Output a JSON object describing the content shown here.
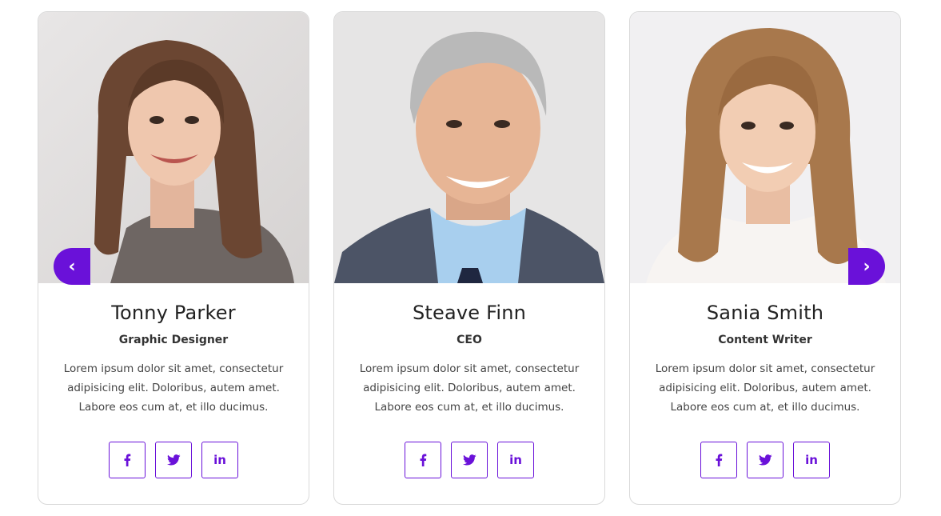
{
  "carousel": {
    "prev_icon": "‹",
    "next_icon": "›",
    "accent_color": "#6a11d9"
  },
  "members": [
    {
      "name": "Tonny Parker",
      "role": "Graphic Designer",
      "bio": "Lorem ipsum dolor sit amet, consectetur adipisicing elit. Doloribus, autem amet. Labore eos cum at, et illo ducimus.",
      "photo_icon": "woman-brown-hair-photo",
      "social": {
        "facebook": "facebook-icon",
        "twitter": "twitter-icon",
        "linkedin": "in"
      }
    },
    {
      "name": "Steave Finn",
      "role": "CEO",
      "bio": "Lorem ipsum dolor sit amet, consectetur adipisicing elit. Doloribus, autem amet. Labore eos cum at, et illo ducimus.",
      "photo_icon": "man-gray-hair-suit-photo",
      "social": {
        "facebook": "facebook-icon",
        "twitter": "twitter-icon",
        "linkedin": "in"
      }
    },
    {
      "name": "Sania Smith",
      "role": "Content Writer",
      "bio": "Lorem ipsum dolor sit amet, consectetur adipisicing elit. Doloribus, autem amet. Labore eos cum at, et illo ducimus.",
      "photo_icon": "woman-blonde-hair-photo",
      "social": {
        "facebook": "facebook-icon",
        "twitter": "twitter-icon",
        "linkedin": "in"
      }
    }
  ]
}
